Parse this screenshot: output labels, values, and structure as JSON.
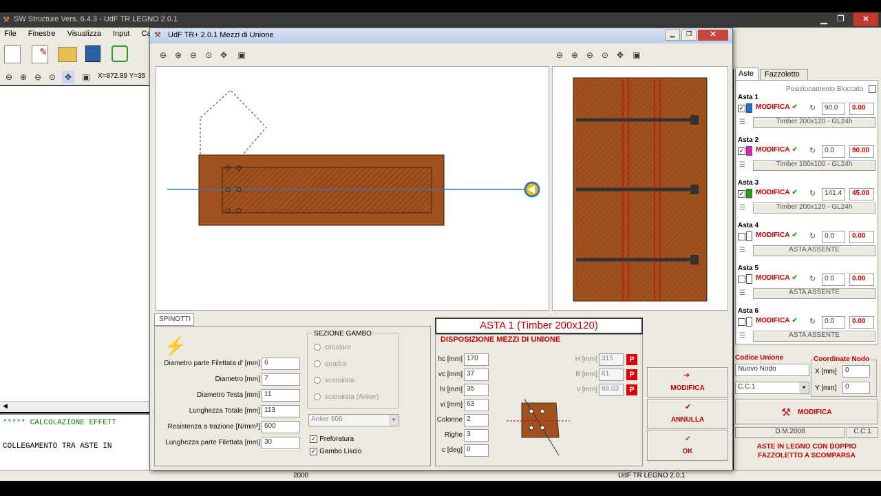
{
  "main_window": {
    "title": "SW Structure Vers. 6.4.3 - UdF TR LEGNO 2.0.1",
    "coords": "X=872.89 Y=35",
    "menu": [
      "File",
      "Finestre",
      "Visualizza",
      "Input",
      "Calco"
    ],
    "console": [
      "***** CALCOLAZIONE EFFETT",
      "COLLEGAMENTO TRA ASTE IN"
    ],
    "status_left": "2000",
    "status_right": "UdF TR LEGNO 2.0.1"
  },
  "dialog": {
    "title": "UdF TR+ 2.0.1   Mezzi di Unione",
    "tab": "SPINOTTI",
    "fields": [
      {
        "label": "Diametro parte Filettata d' [mm]",
        "value": "6"
      },
      {
        "label": "Diametro [mm]",
        "value": "7"
      },
      {
        "label": "Diametro Testa [mm]",
        "value": "11"
      },
      {
        "label": "Lunghezza Totale [mm]",
        "value": "113"
      },
      {
        "label": "Resistenza a trazione [N/mm²]",
        "value": "600"
      },
      {
        "label": "Lunghezza parte Filettata [mm]",
        "value": "30"
      }
    ],
    "sezione": {
      "title": "SEZIONE GAMBO",
      "options": [
        "circolare",
        "quadra",
        "scanalata",
        "scanalata (Anker)"
      ]
    },
    "anker": "Anker 606",
    "checks": [
      {
        "label": "Preforatura",
        "checked": true
      },
      {
        "label": "Gambo Liscio",
        "checked": true
      }
    ],
    "asta_title": "ASTA 1 (Timber 200x120)",
    "disp_title": "DISPOSIZIONE MEZZI DI UNIONE",
    "params_left": [
      {
        "label": "hc [mm]",
        "value": "170"
      },
      {
        "label": "vc [mm]",
        "value": "37"
      },
      {
        "label": "hi [mm]",
        "value": "35"
      },
      {
        "label": "vi [mm]",
        "value": "63"
      },
      {
        "label": "Colonne",
        "value": "2"
      },
      {
        "label": "Righe",
        "value": "3"
      },
      {
        "label": "c [deg]",
        "value": "0"
      }
    ],
    "params_right": [
      {
        "label": "H [mm]",
        "value": "315",
        "p": "P"
      },
      {
        "label": "B [mm]",
        "value": "61",
        "p": "P"
      },
      {
        "label": "v [mm]",
        "value": "68.03",
        "p": "P"
      }
    ],
    "buttons": {
      "modifica": "MODIFICA",
      "annulla": "ANNULLA",
      "ok": "OK"
    }
  },
  "right_panel": {
    "tabs": [
      "Aste",
      "Fazzoletto"
    ],
    "posizionamento": "Posizionamento Bloccato",
    "aste": [
      {
        "title": "Asta 1",
        "checked": true,
        "color": "#1a6fe0",
        "modifica": "MODIFICA",
        "angle": "90.0",
        "val": "0.00",
        "desc": "Timber 200x120 - GL24h"
      },
      {
        "title": "Asta 2",
        "checked": true,
        "color": "#e020c0",
        "modifica": "MODIFICA",
        "angle": "0.0",
        "val": "90.00",
        "desc": "Timber 100x100 - GL24h"
      },
      {
        "title": "Asta 3",
        "checked": true,
        "color": "#20a020",
        "modifica": "MODIFICA",
        "angle": "141.4",
        "val": "45.00",
        "desc": "Timber 200x120 - GL24h"
      },
      {
        "title": "Asta 4",
        "checked": false,
        "color": "#ffffff",
        "modifica": "MODIFICA",
        "angle": "0.0",
        "val": "0.00",
        "desc": "ASTA ASSENTE"
      },
      {
        "title": "Asta 5",
        "checked": false,
        "color": "#ffffff",
        "modifica": "MODIFICA",
        "angle": "0.0",
        "val": "0.00",
        "desc": "ASTA ASSENTE"
      },
      {
        "title": "Asta 6",
        "checked": false,
        "color": "#ffffff",
        "modifica": "MODIFICA",
        "angle": "0.0",
        "val": "0.00",
        "desc": "ASTA ASSENTE"
      }
    ],
    "codice_label": "Codice Unione",
    "codice_value": "Nuovo Nodo",
    "cc_select": "C.C.1",
    "coord_label": "Coordinate Nodo",
    "x_label": "X  [mm]",
    "x_value": "0",
    "y_label": "Y  [mm]",
    "y_value": "0",
    "modifica_big": "MODIFICA",
    "dm": "D.M.2008",
    "cc1": "C.C.1",
    "footer": "ASTE IN LEGNO CON DOPPIO FAZZOLETTO A SCOMPARSA"
  }
}
